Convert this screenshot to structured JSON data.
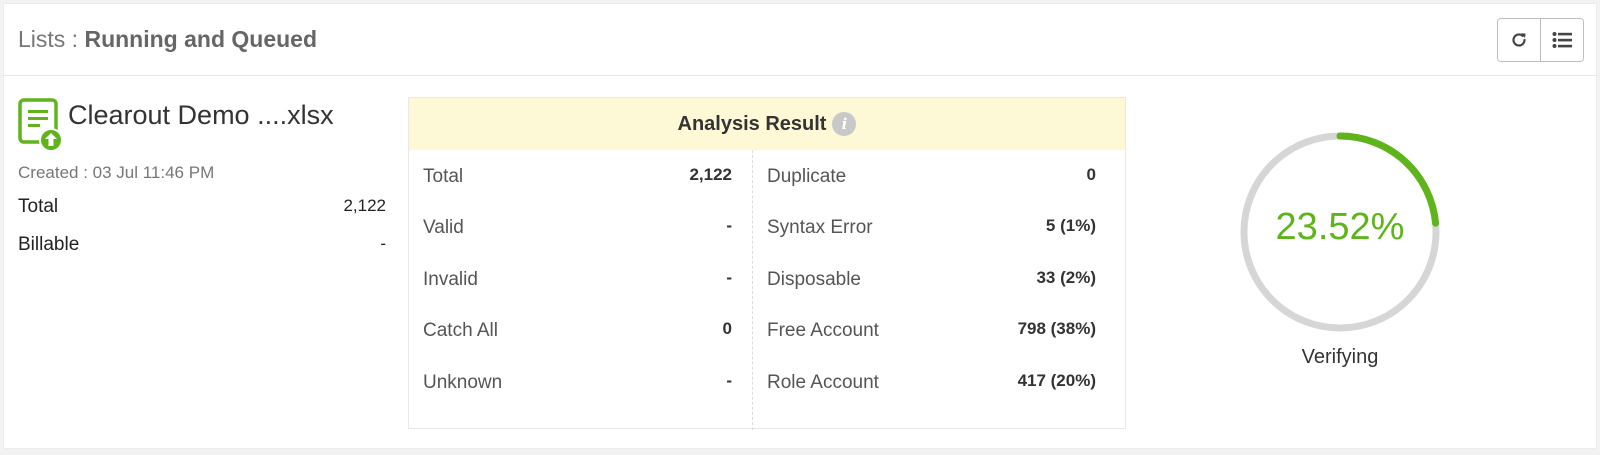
{
  "header": {
    "prefix": "Lists : ",
    "title": "Running and Queued",
    "buttons": [
      "refresh-icon",
      "list-icon"
    ]
  },
  "file": {
    "icon": "file-upload-icon",
    "name": "Clearout Demo ....xlsx",
    "created": "Created : 03 Jul 11:46 PM",
    "stats": [
      {
        "label": "Total",
        "value": "2,122"
      },
      {
        "label": "Billable",
        "value": "-"
      }
    ]
  },
  "analysis": {
    "title": "Analysis Result",
    "info_icon": "i",
    "left": [
      {
        "label": "Total",
        "value": "2,122"
      },
      {
        "label": "Valid",
        "value": "-"
      },
      {
        "label": "Invalid",
        "value": "-"
      },
      {
        "label": "Catch All",
        "value": "0"
      },
      {
        "label": "Unknown",
        "value": "-"
      }
    ],
    "right": [
      {
        "label": "Duplicate",
        "value": "0"
      },
      {
        "label": "Syntax Error",
        "value": "5 (1%)"
      },
      {
        "label": "Disposable",
        "value": "33 (2%)"
      },
      {
        "label": "Free Account",
        "value": "798 (38%)"
      },
      {
        "label": "Role Account",
        "value": "417 (20%)"
      }
    ]
  },
  "progress": {
    "percent_text": "23.52%",
    "fraction": 0.2352,
    "status": "Verifying",
    "color": "#5fb41c",
    "track_color": "#d6d6d6"
  }
}
